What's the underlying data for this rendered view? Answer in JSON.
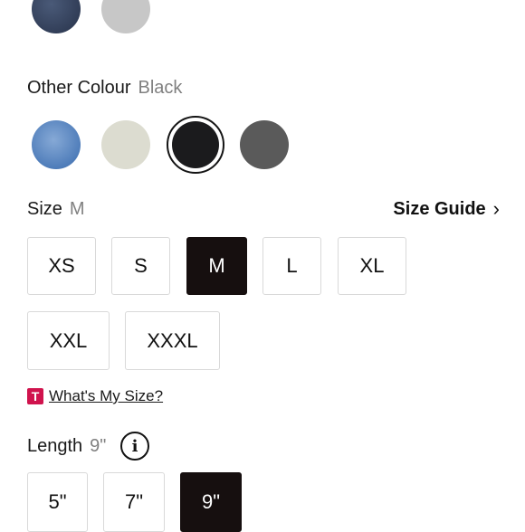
{
  "colour": {
    "label": "Other Colour",
    "selected": "Black",
    "top_swatches": [
      "Navy",
      "Light Grey"
    ],
    "swatches": [
      {
        "name": "Denim Blue",
        "color": "#5a86c2"
      },
      {
        "name": "Light Sage",
        "color": "#dcdcd0"
      },
      {
        "name": "Black",
        "color": "#1b1b1d",
        "selected": true
      },
      {
        "name": "Charcoal",
        "color": "#5a5a5a"
      }
    ]
  },
  "size": {
    "label": "Size",
    "selected": "M",
    "guide_label": "Size Guide",
    "guide_chevron": "›",
    "options": [
      "XS",
      "S",
      "M",
      "L",
      "XL",
      "XXL",
      "XXXL"
    ]
  },
  "whats_my_size": {
    "badge": "T",
    "label": "What's My Size?"
  },
  "length": {
    "label": "Length",
    "selected": "9\"",
    "info_glyph": "i",
    "options": [
      "5\"",
      "7\"",
      "9\""
    ]
  }
}
